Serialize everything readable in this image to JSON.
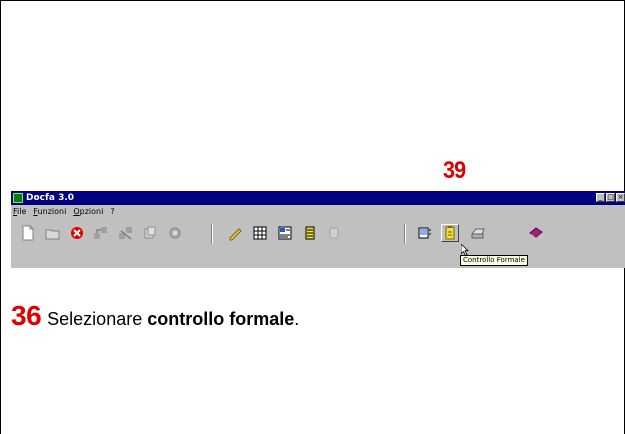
{
  "callout_number": "39",
  "window": {
    "title": "Docfa 3.0",
    "minimize": "_",
    "maximize": "□",
    "close": "×"
  },
  "menu": [
    "File",
    "Funzioni",
    "Opzioni",
    "?"
  ],
  "toolbar_icons": [
    "new-document-icon",
    "open-folder-icon",
    "delete-icon",
    "connect-icon",
    "disconnect-icon",
    "copy-icon",
    "settings-icon",
    "pen-icon",
    "grid-icon",
    "form-icon",
    "list-icon",
    "cylinder-icon",
    "document-list-icon",
    "controllo-formale-icon",
    "printer-icon",
    "book-icon"
  ],
  "tooltip": "Controllo Formale",
  "instruction": {
    "number": "36",
    "text_before": "Selezionare ",
    "bold": "controllo formale",
    "text_after": "."
  },
  "colors": {
    "accent_red": "#e00000",
    "titlebar": "#000080",
    "toolbar_bg": "#c0c0c0"
  }
}
